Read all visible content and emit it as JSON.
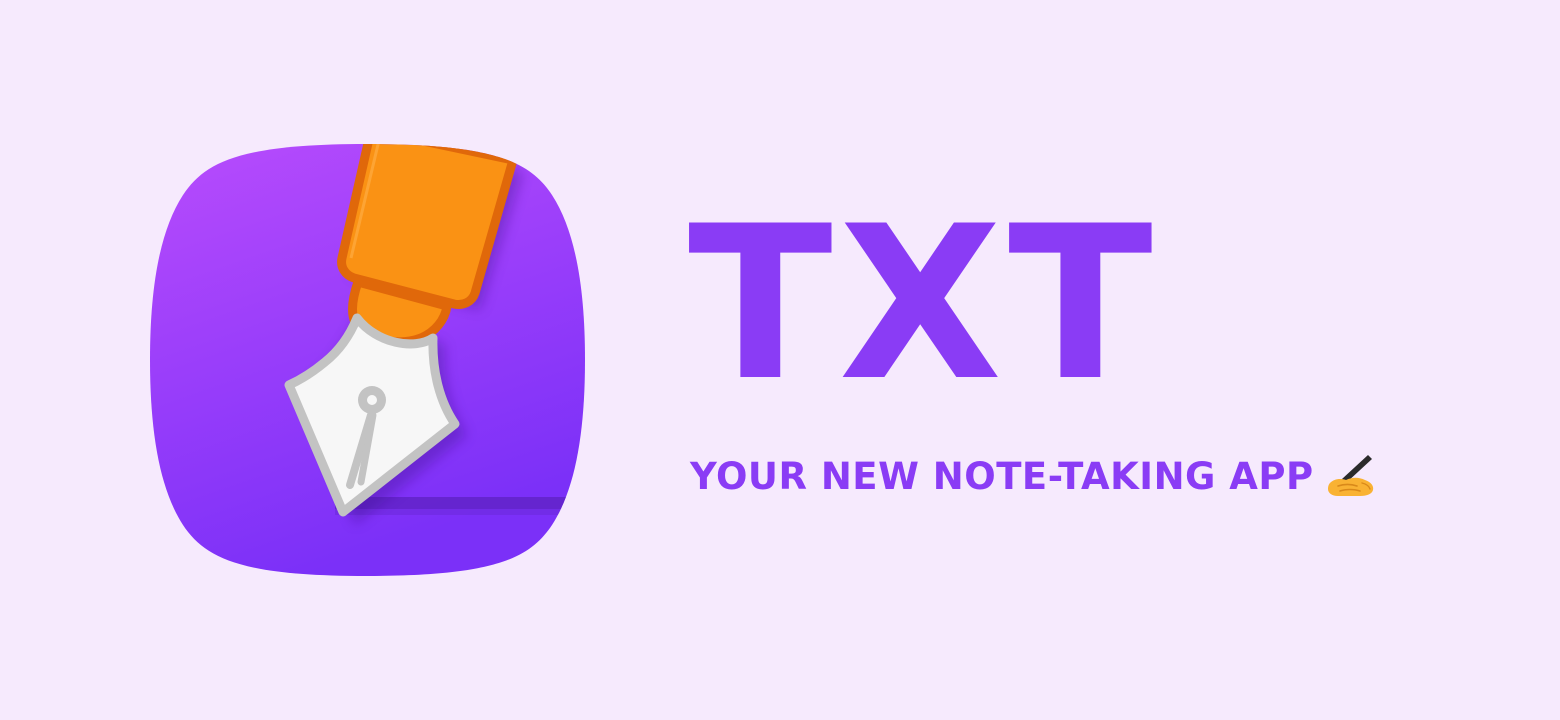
{
  "app_icon": {
    "icon": "fountain-pen-icon",
    "background_gradient": [
      "#b84cfc",
      "#7b30f8"
    ],
    "pen_body_color": "#fa9214",
    "pen_outline_color": "#e0680a",
    "nib_color": "#f7f7f7",
    "nib_outline_color": "#c3c3c3"
  },
  "brand": {
    "name": "TXT",
    "color": "#8a3cf5"
  },
  "tagline": {
    "text": "YOUR NEW NOTE-TAKING APP",
    "icon": "writing-hand-icon"
  },
  "page": {
    "background": "#f6eafd"
  }
}
